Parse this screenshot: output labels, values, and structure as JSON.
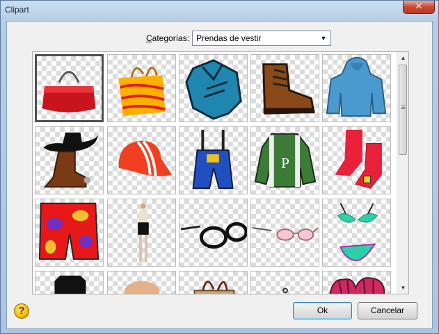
{
  "window": {
    "title": "Clipart",
    "close_label": "✕"
  },
  "category": {
    "label_prefix": "C",
    "label_rest": "ategorías:",
    "selected": "Prendas de vestir"
  },
  "icons": {
    "close": "close-icon",
    "help": "help-icon",
    "dropdown": "chevron-down-icon",
    "scroll_up": "scroll-up-icon",
    "scroll_down": "scroll-down-icon"
  },
  "clipart_items": [
    {
      "name": "handbag"
    },
    {
      "name": "shopping-bag"
    },
    {
      "name": "shirt"
    },
    {
      "name": "boot"
    },
    {
      "name": "hoodie"
    },
    {
      "name": "cowboy-boot-hat"
    },
    {
      "name": "cap"
    },
    {
      "name": "overalls"
    },
    {
      "name": "jacket"
    },
    {
      "name": "socks"
    },
    {
      "name": "shorts"
    },
    {
      "name": "woman-figure"
    },
    {
      "name": "glasses"
    },
    {
      "name": "pink-glasses"
    },
    {
      "name": "bikini"
    },
    {
      "name": "black-shirt"
    },
    {
      "name": "hat-skin"
    },
    {
      "name": "brown-bag"
    },
    {
      "name": "small-item"
    },
    {
      "name": "gloves"
    }
  ],
  "buttons": {
    "help": "?",
    "ok": "Ok",
    "cancel": "Cancelar"
  }
}
